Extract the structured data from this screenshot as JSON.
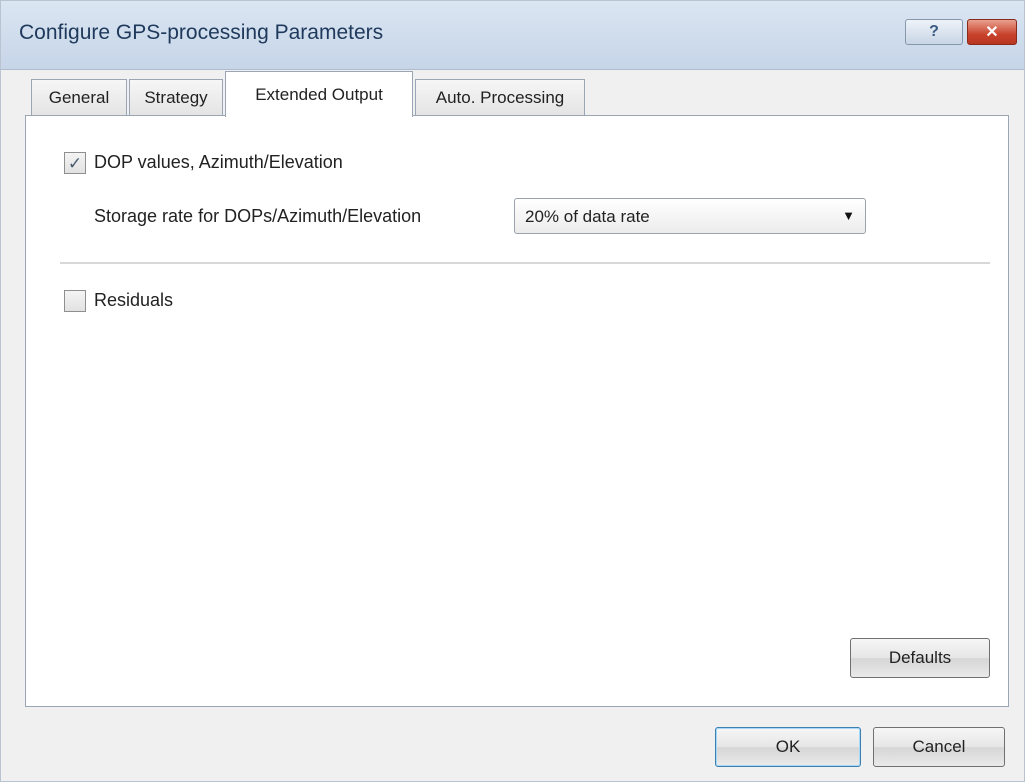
{
  "window": {
    "title": "Configure GPS-processing Parameters",
    "help_glyph": "?",
    "close_glyph": "✕"
  },
  "tabs": [
    {
      "label": "General",
      "active": false
    },
    {
      "label": "Strategy",
      "active": false
    },
    {
      "label": "Extended Output",
      "active": true
    },
    {
      "label": "Auto. Processing",
      "active": false
    }
  ],
  "extended_output": {
    "dop": {
      "label": "DOP values, Azimuth/Elevation",
      "checked": true,
      "check_glyph": "✓"
    },
    "storage_rate": {
      "label": "Storage rate for DOPs/Azimuth/Elevation",
      "value": "20% of data rate",
      "arrow_glyph": "▼"
    },
    "residuals": {
      "label": "Residuals",
      "checked": false
    }
  },
  "buttons": {
    "defaults": "Defaults",
    "ok": "OK",
    "cancel": "Cancel"
  },
  "colors": {
    "title_text": "#1e395b",
    "close_button": "#c8432c",
    "default_button_border": "#3c7fb1"
  }
}
